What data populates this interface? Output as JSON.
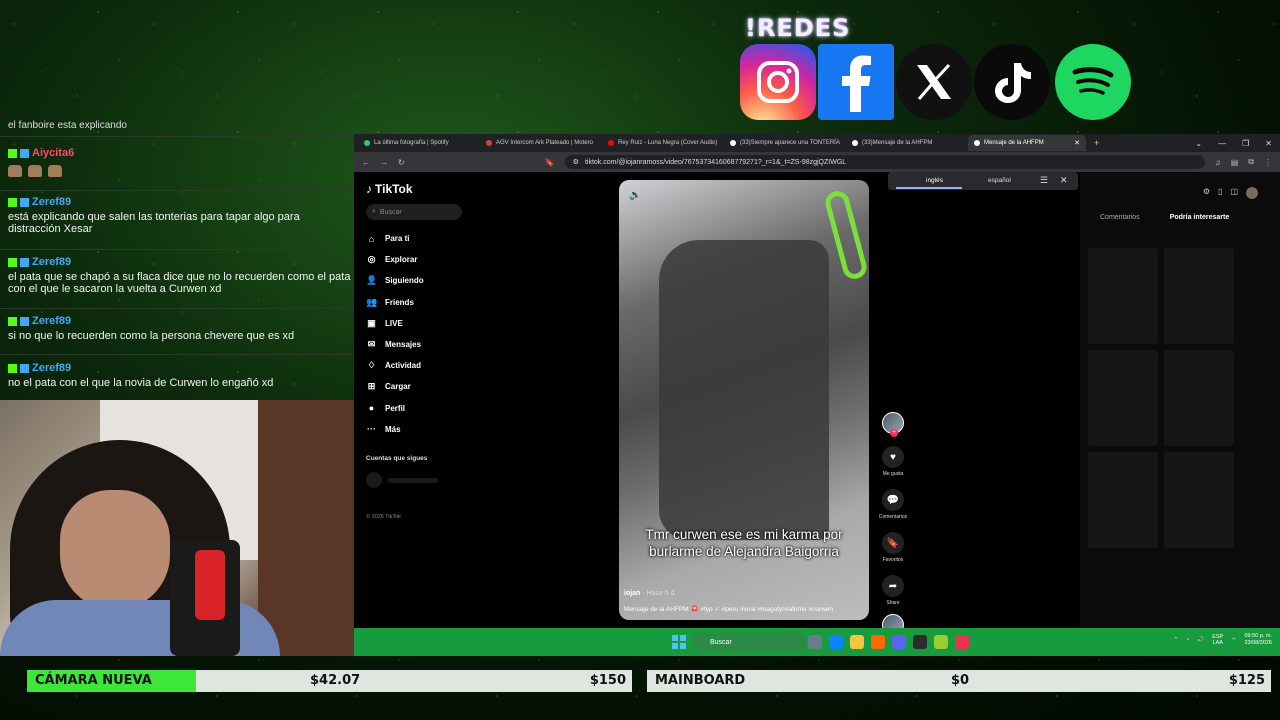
{
  "socials": {
    "title": "!REDES",
    "icons": [
      "instagram-icon",
      "facebook-icon",
      "x-icon",
      "tiktok-icon",
      "spotify-icon"
    ],
    "colors": {
      "instagram": "#d6249f",
      "facebook": "#1877f2",
      "x": "#111111",
      "tiktok": "#0a0a0a",
      "spotify": "#1ed760"
    }
  },
  "chat": {
    "top_line": "el fanboire esta explicando",
    "messages": [
      {
        "user": "Aiycita6",
        "color": "#ff4a63",
        "text": ""
      },
      {
        "user": "Zeref89",
        "color": "#3fa9f5",
        "text": "está explicando que salen las tonterias para tapar algo para distracción Xesar"
      },
      {
        "user": "Zeref89",
        "color": "#3fa9f5",
        "text": "el pata que se chapó a su flaca dice que no lo recuerden como el pata con el que le sacaron la vuelta a Curwen xd"
      },
      {
        "user": "Zeref89",
        "color": "#3fa9f5",
        "text": "si no que lo recuerden como la persona chevere que es xd"
      },
      {
        "user": "Zeref89",
        "color": "#3fa9f5",
        "text": "no el pata con el que la novia de Curwen lo engañó xd"
      }
    ]
  },
  "browser": {
    "tabs": [
      {
        "title": "La última fotografía | Spotify",
        "color": "#1ed760",
        "active": false
      },
      {
        "title": "AGV Intercom Ark Plateado | Motero",
        "color": "#e53935",
        "active": false
      },
      {
        "title": "Rey Ruiz - Luna Negra (Cover Audio)",
        "color": "#ff0000",
        "active": false
      },
      {
        "title": "(33)Siempre aparece una TONTERÍA",
        "color": "#ffffff",
        "active": false
      },
      {
        "title": "(33)Mensaje de la AHFPM",
        "color": "#ffffff",
        "active": false
      },
      {
        "title": "Mensaje de la AHFPM",
        "color": "#ffffff",
        "active": true
      }
    ],
    "url": "tiktok.com/@iojanramoss/video/7675373416068779271?_r=1&_t=ZS-98zgjQZIWGL"
  },
  "tiktok": {
    "logo": "TikTok",
    "search_placeholder": "Buscar",
    "nav": [
      {
        "label": "Para ti",
        "icon": "home-icon",
        "glyph": "⌂"
      },
      {
        "label": "Explorar",
        "icon": "compass-icon",
        "glyph": "◎"
      },
      {
        "label": "Siguiendo",
        "icon": "following-icon",
        "glyph": "👤"
      },
      {
        "label": "Friends",
        "icon": "friends-icon",
        "glyph": "👥"
      },
      {
        "label": "LIVE",
        "icon": "live-icon",
        "glyph": "▣"
      },
      {
        "label": "Mensajes",
        "icon": "messages-icon",
        "glyph": "✉"
      },
      {
        "label": "Actividad",
        "icon": "activity-icon",
        "glyph": "♢"
      },
      {
        "label": "Cargar",
        "icon": "upload-icon",
        "glyph": "⊞"
      },
      {
        "label": "Perfil",
        "icon": "profile-icon",
        "glyph": "●"
      },
      {
        "label": "Más",
        "icon": "more-icon",
        "glyph": "···"
      }
    ],
    "following_title": "Cuentas que sigues",
    "copyright": "© 2026 TikTok",
    "video": {
      "caption_line1": "Tmr curwen ese es mi karma por",
      "caption_line2": "burlarme de Alejandra Baigorria",
      "author": "iojan",
      "time": " · Hace 5 d",
      "description": "Mensaje de la AHFPM 🚨 #fyp ✓ #peru #viral #magalytvlafirme #curwen"
    },
    "actions": [
      {
        "label": "Me gusta",
        "icon": "heart-icon",
        "glyph": "♥"
      },
      {
        "label": "Comentarios",
        "icon": "comment-icon",
        "glyph": "💬"
      },
      {
        "label": "Favoritos",
        "icon": "bookmark-icon",
        "glyph": "🔖"
      },
      {
        "label": "Share",
        "icon": "share-icon",
        "glyph": "➦"
      }
    ],
    "translate": {
      "lang1": "inglés",
      "lang2": "español"
    },
    "right_tabs": [
      "Comentarios",
      "Podría interesarte"
    ]
  },
  "taskbar": {
    "search": "Buscar",
    "lang_top": "ESP",
    "lang_bottom": "LAA",
    "time": "09:50 p. m.",
    "date": "23/08/2026"
  },
  "goals": [
    {
      "name": "CÁMARA NUEVA",
      "current": "$42.07",
      "target": "$150",
      "progress": 0.28
    },
    {
      "name": "MAINBOARD",
      "current": "$0",
      "target": "$125",
      "progress": 0.0
    }
  ]
}
